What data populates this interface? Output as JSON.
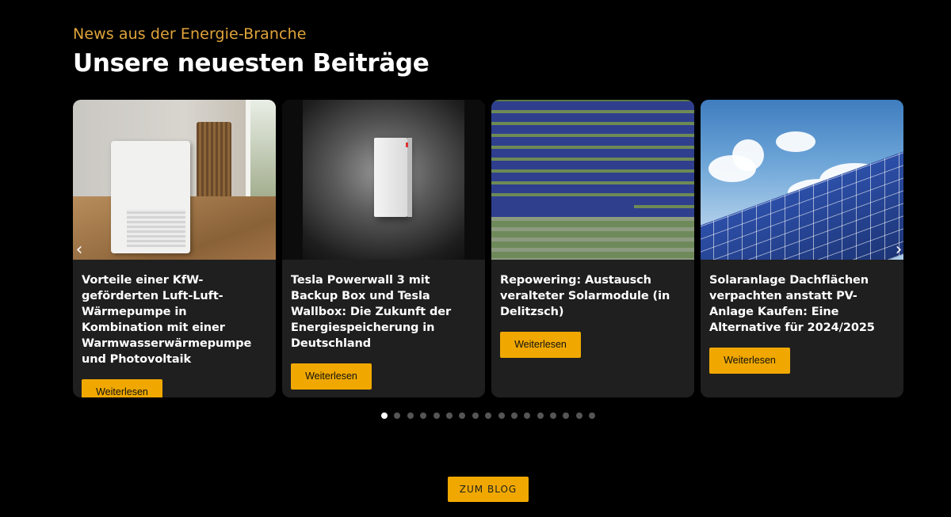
{
  "header": {
    "eyebrow": "News aus der Energie-Branche",
    "title": "Unsere neuesten Beiträge"
  },
  "cards": [
    {
      "title": "Vorteile einer KfW-geförderten Luft-Luft-Wärmepumpe in Kombination mit einer Warmwasserwärmepumpe und Photovoltaik",
      "button": "Weiterlesen"
    },
    {
      "title": "Tesla Powerwall 3 mit Backup Box und Tesla Wallbox: Die Zukunft der Energiespeicherung in Deutschland",
      "button": "Weiterlesen"
    },
    {
      "title": "Repowering: Austausch veralteter Solarmodule (in Delitzsch)",
      "button": "Weiterlesen"
    },
    {
      "title": "Solaranlage Dachflächen verpachten anstatt PV-Anlage Kaufen: Eine Alternative für 2024/2025",
      "button": "Weiterlesen"
    }
  ],
  "carousel": {
    "prev_icon": "chevron-left-icon",
    "next_icon": "chevron-right-icon",
    "dot_count": 17,
    "active_dot": 1
  },
  "blog_button": "ZUM BLOG",
  "colors": {
    "accent": "#f0a800",
    "eyebrow": "#e0a43a",
    "card_bg": "#1f1f1f",
    "page_bg": "#000000"
  }
}
